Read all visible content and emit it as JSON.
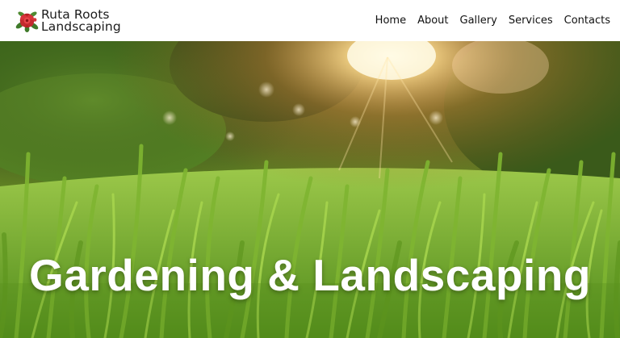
{
  "brand": {
    "line1": "Ruta Roots",
    "line2": "Landscaping",
    "logo_icon": "rose-flower-icon",
    "logo_color": "#c62a2a"
  },
  "nav": {
    "items": [
      {
        "label": "Home"
      },
      {
        "label": "About"
      },
      {
        "label": "Gallery"
      },
      {
        "label": "Services"
      },
      {
        "label": "Contacts"
      }
    ]
  },
  "hero": {
    "title": "Gardening & Landscaping",
    "image": "sunlit-grass-closeup-image"
  }
}
